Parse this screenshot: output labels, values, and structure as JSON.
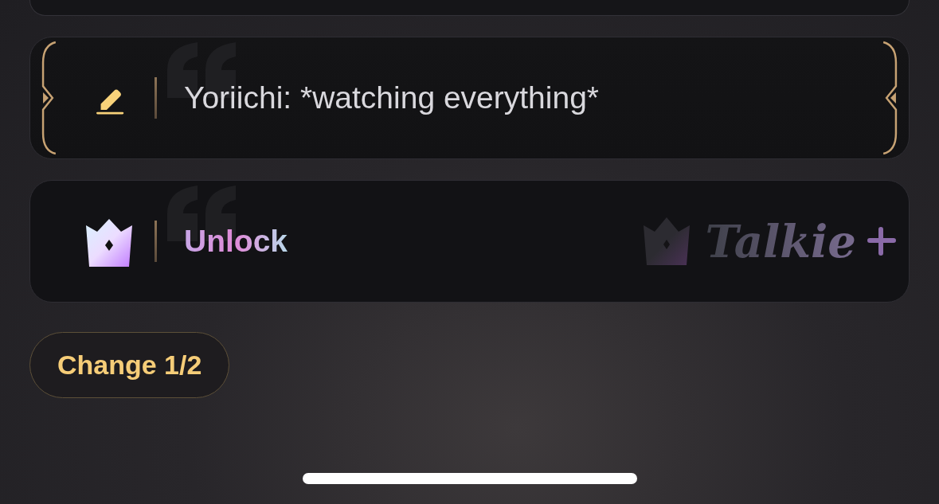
{
  "options": [
    {
      "kind": "text",
      "text": "Yoriichi: *watching everything*",
      "selected": true
    },
    {
      "kind": "unlock",
      "text": "Unlock",
      "selected": false,
      "brand": "Talkie"
    }
  ],
  "change_button": {
    "label": "Change 1/2"
  }
}
